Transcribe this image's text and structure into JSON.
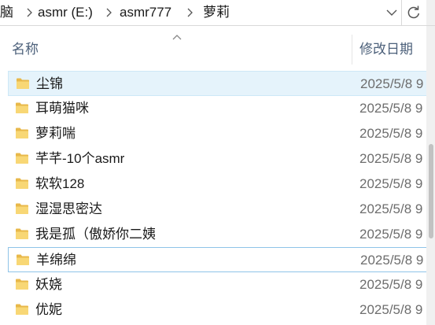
{
  "breadcrumb": {
    "items": [
      "脑",
      "asmr (E:)",
      "asmr777",
      "萝莉"
    ]
  },
  "header": {
    "name_col": "名称",
    "date_col": "修改日期"
  },
  "files": [
    {
      "name": "尘锦",
      "date": "2025/5/8 9"
    },
    {
      "name": "耳萌猫咪",
      "date": "2025/5/8 9"
    },
    {
      "name": "萝莉喘",
      "date": "2025/5/8 9"
    },
    {
      "name": "芊芊-10个asmr",
      "date": "2025/5/8 9"
    },
    {
      "name": "软软128",
      "date": "2025/5/8 9"
    },
    {
      "name": "湿湿思密达",
      "date": "2025/5/8 9"
    },
    {
      "name": "我是孤（傲娇你二姨",
      "date": "2025/5/8 9"
    },
    {
      "name": "羊绵绵",
      "date": "2025/5/8 9"
    },
    {
      "name": "妖娆",
      "date": "2025/5/8 9"
    },
    {
      "name": "优妮",
      "date": "2025/5/8 9"
    }
  ],
  "icons": {
    "folder": "folder-icon",
    "separator": "chevron-right-icon",
    "dropdown": "chevron-down-icon",
    "refresh": "refresh-icon",
    "sort": "sort-ascending-icon"
  },
  "colors": {
    "selected_bg": "#e5f3fb",
    "folder_yellow": "#f8d775",
    "header_text": "#4c607a"
  }
}
